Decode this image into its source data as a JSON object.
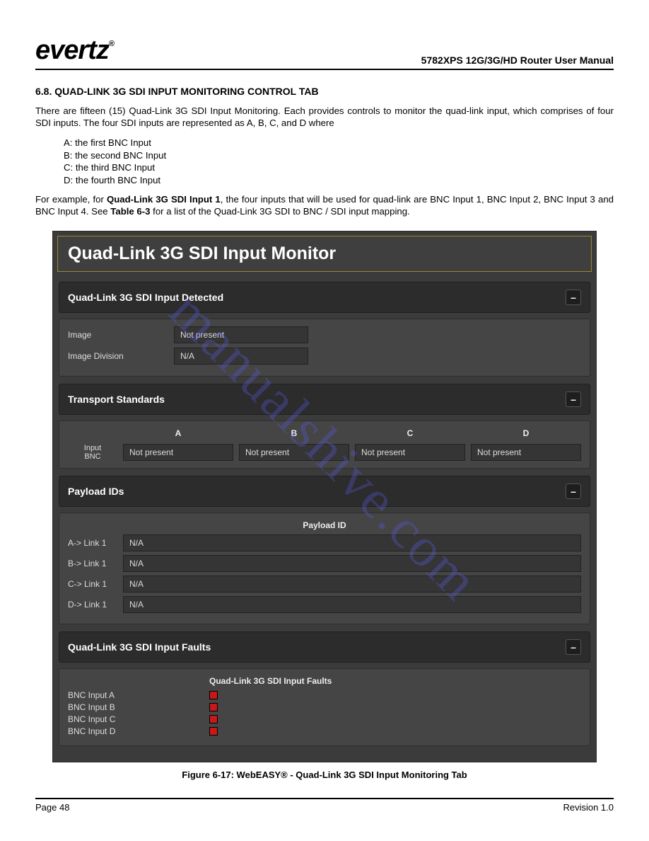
{
  "header": {
    "logo": "evertz",
    "logo_mark": "®",
    "doc_title": "5782XPS 12G/3G/HD Router User Manual"
  },
  "section_number_title": "6.8.   QUAD-LINK 3G SDI INPUT MONITORING CONTROL TAB",
  "paragraphs": {
    "p1": "There are fifteen (15) Quad-Link 3G SDI Input Monitoring. Each provides controls to monitor the quad-link input, which comprises of four SDI inputs. The four SDI inputs are represented as A, B, C, and D where",
    "p2_prefix": "For example, for ",
    "p2_bold_1": "Quad-Link 3G SDI Input 1",
    "p2_mid": ", the four inputs that will be used for quad-link are BNC Input 1, BNC Input 2, BNC Input 3 and BNC Input 4. See ",
    "p2_bold_2": "Table 6-3",
    "p2_suffix": " for a list of the Quad-Link 3G SDI to BNC / SDI input mapping.",
    "li_a": "A: the first BNC Input",
    "li_b": "B: the second BNC Input",
    "li_c": "C: the third BNC Input",
    "li_d": "D: the fourth BNC Input"
  },
  "panel": {
    "title": "Quad-Link 3G SDI Input Monitor",
    "detected": {
      "header": "Quad-Link 3G SDI Input Detected",
      "collapse": "–",
      "rows": [
        {
          "label": "Image",
          "value": "Not present"
        },
        {
          "label": "Image Division",
          "value": "N/A"
        }
      ]
    },
    "transport": {
      "header": "Transport Standards",
      "collapse": "–",
      "row_label_1": "Input",
      "row_label_2": "BNC",
      "columns": [
        "A",
        "B",
        "C",
        "D"
      ],
      "values": [
        "Not present",
        "Not present",
        "Not present",
        "Not present"
      ]
    },
    "payload": {
      "header": "Payload IDs",
      "collapse": "–",
      "col_header": "Payload ID",
      "rows": [
        {
          "label": "A-> Link 1",
          "value": "N/A"
        },
        {
          "label": "B-> Link 1",
          "value": "N/A"
        },
        {
          "label": "C-> Link 1",
          "value": "N/A"
        },
        {
          "label": "D-> Link 1",
          "value": "N/A"
        }
      ]
    },
    "faults": {
      "header": "Quad-Link 3G SDI Input Faults",
      "collapse": "–",
      "col_header": "Quad-Link 3G SDI Input Faults",
      "rows": [
        {
          "label": "BNC Input A",
          "status": "fault"
        },
        {
          "label": "BNC Input B",
          "status": "fault"
        },
        {
          "label": "BNC Input C",
          "status": "fault"
        },
        {
          "label": "BNC Input D",
          "status": "fault"
        }
      ]
    }
  },
  "figure_caption": "Figure 6-17: WebEASY® - Quad-Link 3G SDI Input Monitoring Tab",
  "footer": {
    "left": "Page 48",
    "right": "Revision 1.0"
  },
  "watermark": "manualshive.com"
}
